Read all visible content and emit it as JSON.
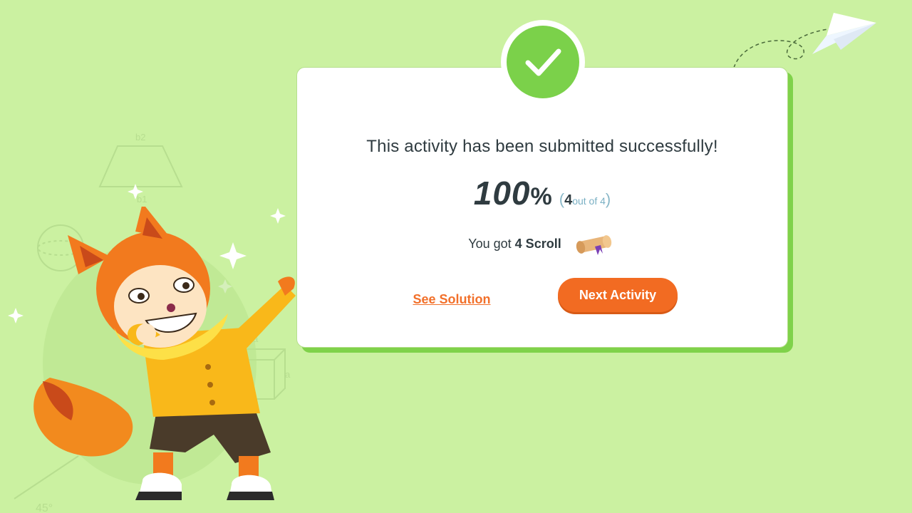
{
  "dialog": {
    "headline": "This activity has been submitted successfully!",
    "score": {
      "percent": "100",
      "percent_symbol": "%",
      "open_paren": "(",
      "correct": "4",
      "out_of_text": "out of 4",
      "close_paren": ")"
    },
    "reward": {
      "prefix": "You got ",
      "amount_label": "4 Scroll",
      "icon": "scroll-icon"
    },
    "see_solution_label": "See Solution",
    "next_activity_label": "Next Activity",
    "status_icon": "checkmark-icon"
  },
  "background": {
    "trapezoid_label": "b2",
    "trapezoid_label_bottom": "b1",
    "cube_label": "a",
    "angle_label": "45°"
  },
  "colors": {
    "background": "#cbf1a1",
    "card": "#ffffff",
    "card_shadow": "#7fd24a",
    "check_green": "#7bd14a",
    "accent_orange": "#f26b22",
    "text_dark": "#2f3b40",
    "text_muted_blue": "#8ab8c8"
  }
}
